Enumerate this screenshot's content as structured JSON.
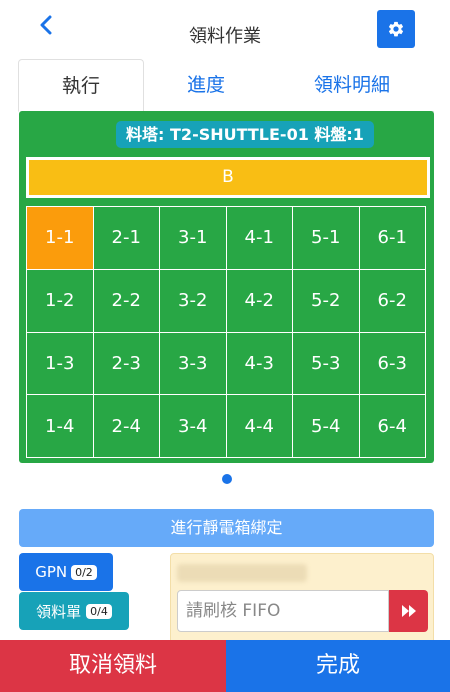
{
  "header": {
    "title": "領料作業",
    "back_icon": "chevron-left-icon",
    "settings_icon": "gear-icon"
  },
  "tabs": [
    {
      "label": "執行",
      "active": true
    },
    {
      "label": "進度",
      "active": false
    },
    {
      "label": "領料明細",
      "active": false
    }
  ],
  "panel": {
    "tower_label": "料塔: T2-SHUTTLE-01 料盤:1",
    "bar_label": "B",
    "selected_cell": "1-1",
    "cells": [
      [
        "1-1",
        "2-1",
        "3-1",
        "4-1",
        "5-1",
        "6-1"
      ],
      [
        "1-2",
        "2-2",
        "3-2",
        "4-2",
        "5-2",
        "6-2"
      ],
      [
        "1-3",
        "2-3",
        "3-3",
        "4-3",
        "5-3",
        "6-3"
      ],
      [
        "1-4",
        "2-4",
        "3-4",
        "4-4",
        "5-4",
        "6-4"
      ]
    ]
  },
  "actions": {
    "bind_label": "進行靜電箱綁定",
    "gpn_label": "GPN",
    "gpn_count": "0/2",
    "material_label": "領料單",
    "material_count": "0/4"
  },
  "scan": {
    "placeholder": "請刷核 FIFO",
    "go_icon": "double-chevron-right-icon"
  },
  "footer": {
    "cancel_label": "取消領料",
    "done_label": "完成"
  },
  "colors": {
    "primary": "#1a73e8",
    "success": "#28a745",
    "warning": "#f9be14",
    "selected": "#fb9c0c",
    "info": "#17a2b8",
    "danger": "#dc3545"
  }
}
